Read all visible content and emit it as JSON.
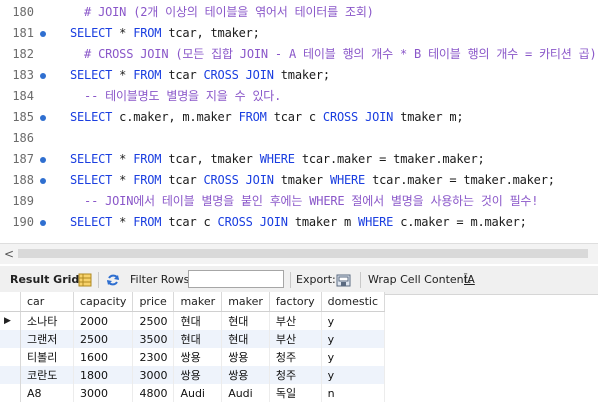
{
  "editor": {
    "lines": [
      {
        "num": "180",
        "dot": false,
        "segments": [
          {
            "t": "  # JOIN (2개 이상의 테이블을 엮어서 테이터를 조회)",
            "c": "cm"
          }
        ]
      },
      {
        "num": "181",
        "dot": true,
        "segments": [
          {
            "t": "SELECT",
            "c": "kw"
          },
          {
            "t": " * ",
            "c": ""
          },
          {
            "t": "FROM",
            "c": "kw"
          },
          {
            "t": " tcar, tmaker;",
            "c": ""
          }
        ]
      },
      {
        "num": "182",
        "dot": false,
        "segments": [
          {
            "t": "  # CROSS JOIN (모든 집합 JOIN - A 테이블 행의 개수 * B 테이블 행의 개수 = 카티션 곱)",
            "c": "cm"
          }
        ]
      },
      {
        "num": "183",
        "dot": true,
        "segments": [
          {
            "t": "SELECT",
            "c": "kw"
          },
          {
            "t": " * ",
            "c": ""
          },
          {
            "t": "FROM",
            "c": "kw"
          },
          {
            "t": " tcar ",
            "c": ""
          },
          {
            "t": "CROSS JOIN",
            "c": "kw"
          },
          {
            "t": " tmaker;",
            "c": ""
          }
        ]
      },
      {
        "num": "184",
        "dot": false,
        "segments": [
          {
            "t": "  -- 테이블명도 별명을 지을 수 있다.",
            "c": "cm"
          }
        ]
      },
      {
        "num": "185",
        "dot": true,
        "segments": [
          {
            "t": "SELECT",
            "c": "kw"
          },
          {
            "t": " c.maker, m.maker ",
            "c": ""
          },
          {
            "t": "FROM",
            "c": "kw"
          },
          {
            "t": " tcar c ",
            "c": ""
          },
          {
            "t": "CROSS JOIN",
            "c": "kw"
          },
          {
            "t": " tmaker m;",
            "c": ""
          }
        ]
      },
      {
        "num": "186",
        "dot": false,
        "segments": []
      },
      {
        "num": "187",
        "dot": true,
        "segments": [
          {
            "t": "SELECT",
            "c": "kw"
          },
          {
            "t": " * ",
            "c": ""
          },
          {
            "t": "FROM",
            "c": "kw"
          },
          {
            "t": " tcar, tmaker ",
            "c": ""
          },
          {
            "t": "WHERE",
            "c": "kw"
          },
          {
            "t": " tcar.maker = tmaker.maker;",
            "c": ""
          }
        ]
      },
      {
        "num": "188",
        "dot": true,
        "segments": [
          {
            "t": "SELECT",
            "c": "kw"
          },
          {
            "t": " * ",
            "c": ""
          },
          {
            "t": "FROM",
            "c": "kw"
          },
          {
            "t": " tcar ",
            "c": ""
          },
          {
            "t": "CROSS JOIN",
            "c": "kw"
          },
          {
            "t": " tmaker ",
            "c": ""
          },
          {
            "t": "WHERE",
            "c": "kw"
          },
          {
            "t": " tcar.maker = tmaker.maker;",
            "c": ""
          }
        ]
      },
      {
        "num": "189",
        "dot": false,
        "segments": [
          {
            "t": "  -- JOIN에서 테이블 별명을 붙인 후에는 WHERE 절에서 별명을 사용하는 것이 필수!",
            "c": "cm"
          }
        ]
      },
      {
        "num": "190",
        "dot": true,
        "segments": [
          {
            "t": "SELECT",
            "c": "kw"
          },
          {
            "t": " * ",
            "c": ""
          },
          {
            "t": "FROM",
            "c": "kw"
          },
          {
            "t": " tcar c ",
            "c": ""
          },
          {
            "t": "CROSS JOIN",
            "c": "kw"
          },
          {
            "t": " tmaker m ",
            "c": ""
          },
          {
            "t": "WHERE",
            "c": "kw"
          },
          {
            "t": " c.maker = m.maker;",
            "c": ""
          }
        ]
      }
    ]
  },
  "toolbar": {
    "result_grid_label": "Result Grid",
    "filter_rows_label": "Filter Rows:",
    "filter_value": "",
    "export_label": "Export:",
    "wrap_cell_label": "Wrap Cell Content:",
    "wrap_glyph": "ĪA"
  },
  "grid": {
    "columns": [
      "car",
      "capacity",
      "price",
      "maker",
      "maker",
      "factory",
      "domestic"
    ],
    "rows": [
      [
        "소나타",
        "2000",
        "2500",
        "현대",
        "현대",
        "부산",
        "y"
      ],
      [
        "그랜저",
        "2500",
        "3500",
        "현대",
        "현대",
        "부산",
        "y"
      ],
      [
        "티볼리",
        "1600",
        "2300",
        "쌍용",
        "쌍용",
        "청주",
        "y"
      ],
      [
        "코란도",
        "1800",
        "3000",
        "쌍용",
        "쌍용",
        "청주",
        "y"
      ],
      [
        "A8",
        "3000",
        "4800",
        "Audi",
        "Audi",
        "독일",
        "n"
      ]
    ],
    "current_row_marker": "▶"
  }
}
